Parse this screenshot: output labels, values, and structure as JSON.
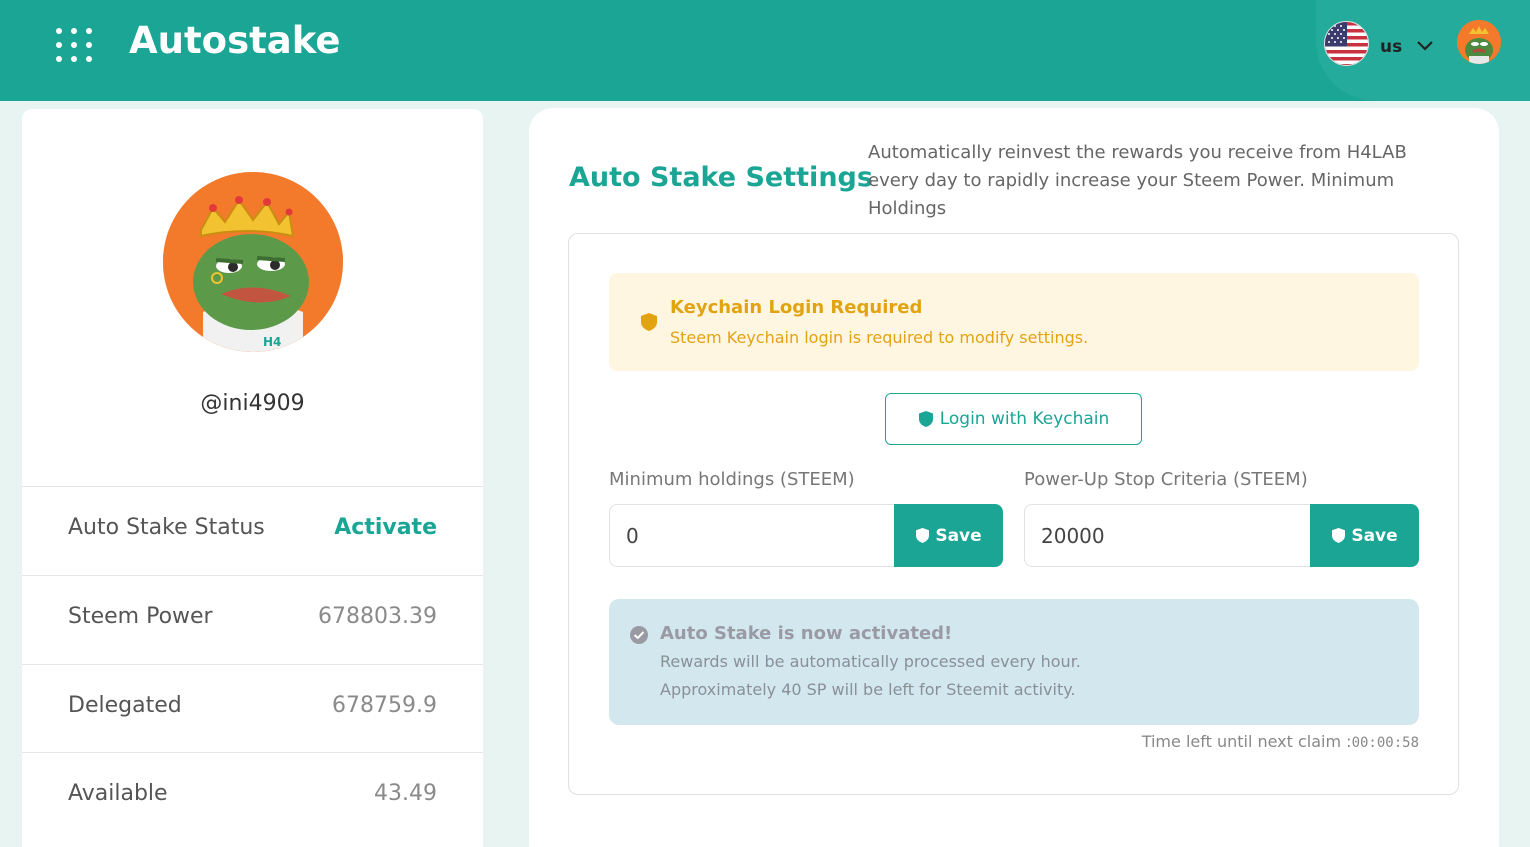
{
  "header": {
    "app_title": "Autostake",
    "language": "us",
    "menu_icon": "grid-menu-icon",
    "flag_icon": "us-flag-icon",
    "chevron_icon": "chevron-down-icon",
    "avatar_icon": "user-avatar-icon"
  },
  "profile": {
    "username": "@ini4909",
    "stats": [
      {
        "label": "Auto Stake Status",
        "value": "Activate"
      },
      {
        "label": "Steem Power",
        "value": "678803.39"
      },
      {
        "label": "Delegated",
        "value": "678759.9"
      },
      {
        "label": "Available",
        "value": "43.49"
      }
    ]
  },
  "settings": {
    "title": "Auto Stake Settings",
    "description": "Automatically reinvest the rewards you receive from H4LAB every day to rapidly increase your Steem Power. Minimum Holdings",
    "warning": {
      "title": "Keychain Login Required",
      "text": "Steem Keychain login is required to modify settings."
    },
    "login_button": "Login with Keychain",
    "min_holdings": {
      "label": "Minimum holdings (STEEM)",
      "value": "0",
      "button": "Save"
    },
    "stop_criteria": {
      "label": "Power-Up Stop Criteria (STEEM)",
      "value": "20000",
      "button": "Save"
    },
    "info": {
      "title": "Auto Stake is now activated!",
      "line1": "Rewards will be automatically processed every hour.",
      "line2": "Approximately 40 SP will be left for Steemit activity."
    },
    "timer_label": "Time left until next claim :",
    "timer_value": "00:00:58"
  },
  "colors": {
    "brand": "#1aa595",
    "warning": "#e2a313",
    "info_bg": "#d2e8ee"
  }
}
